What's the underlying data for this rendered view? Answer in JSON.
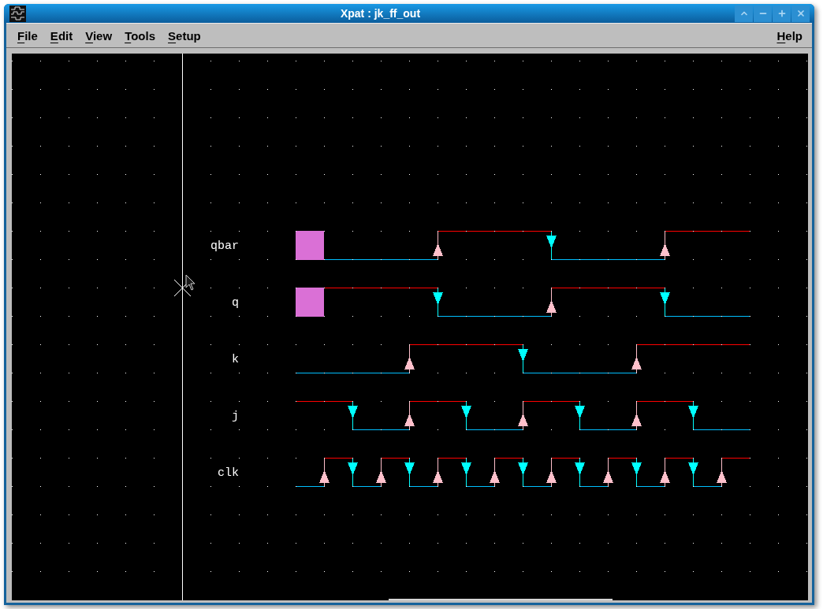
{
  "window": {
    "title": "Xpat : jk_ff_out",
    "controls": [
      {
        "kind": "shade"
      },
      {
        "kind": "minimize"
      },
      {
        "kind": "maximize"
      },
      {
        "kind": "close"
      }
    ]
  },
  "menu_bar": {
    "items": [
      {
        "label": "File"
      },
      {
        "label": "Edit"
      },
      {
        "label": "View"
      },
      {
        "label": "Tools"
      },
      {
        "label": "Setup"
      }
    ],
    "help": {
      "label": "Help"
    }
  },
  "waveform_view": {
    "signals": [
      {
        "name": "qbar",
        "steps": [
          {
            "kind": "unknown"
          },
          {
            "kind": "low"
          },
          {
            "kind": "low"
          },
          {
            "kind": "low"
          },
          {
            "kind": "low"
          },
          {
            "kind": "high"
          },
          {
            "kind": "high"
          },
          {
            "kind": "high"
          },
          {
            "kind": "high"
          },
          {
            "kind": "low"
          },
          {
            "kind": "low"
          },
          {
            "kind": "low"
          },
          {
            "kind": "low"
          },
          {
            "kind": "high"
          },
          {
            "kind": "high"
          },
          {
            "kind": "high"
          }
        ]
      },
      {
        "name": "q",
        "steps": [
          {
            "kind": "unknown"
          },
          {
            "kind": "high"
          },
          {
            "kind": "high"
          },
          {
            "kind": "high"
          },
          {
            "kind": "high"
          },
          {
            "kind": "low"
          },
          {
            "kind": "low"
          },
          {
            "kind": "low"
          },
          {
            "kind": "low"
          },
          {
            "kind": "high"
          },
          {
            "kind": "high"
          },
          {
            "kind": "high"
          },
          {
            "kind": "high"
          },
          {
            "kind": "low"
          },
          {
            "kind": "low"
          },
          {
            "kind": "low"
          }
        ]
      },
      {
        "name": "k",
        "steps": [
          {
            "kind": "low"
          },
          {
            "kind": "low"
          },
          {
            "kind": "low"
          },
          {
            "kind": "low"
          },
          {
            "kind": "high"
          },
          {
            "kind": "high"
          },
          {
            "kind": "high"
          },
          {
            "kind": "high"
          },
          {
            "kind": "low"
          },
          {
            "kind": "low"
          },
          {
            "kind": "low"
          },
          {
            "kind": "low"
          },
          {
            "kind": "high"
          },
          {
            "kind": "high"
          },
          {
            "kind": "high"
          },
          {
            "kind": "high"
          }
        ]
      },
      {
        "name": "j",
        "steps": [
          {
            "kind": "high"
          },
          {
            "kind": "high"
          },
          {
            "kind": "low"
          },
          {
            "kind": "low"
          },
          {
            "kind": "high"
          },
          {
            "kind": "high"
          },
          {
            "kind": "low"
          },
          {
            "kind": "low"
          },
          {
            "kind": "high"
          },
          {
            "kind": "high"
          },
          {
            "kind": "low"
          },
          {
            "kind": "low"
          },
          {
            "kind": "high"
          },
          {
            "kind": "high"
          },
          {
            "kind": "low"
          },
          {
            "kind": "low"
          }
        ]
      },
      {
        "name": "clk",
        "steps": [
          {
            "kind": "low"
          },
          {
            "kind": "high"
          },
          {
            "kind": "low"
          },
          {
            "kind": "high"
          },
          {
            "kind": "low"
          },
          {
            "kind": "high"
          },
          {
            "kind": "low"
          },
          {
            "kind": "high"
          },
          {
            "kind": "low"
          },
          {
            "kind": "high"
          },
          {
            "kind": "low"
          },
          {
            "kind": "high"
          },
          {
            "kind": "low"
          },
          {
            "kind": "high"
          },
          {
            "kind": "low"
          },
          {
            "kind": "high"
          }
        ]
      }
    ]
  }
}
